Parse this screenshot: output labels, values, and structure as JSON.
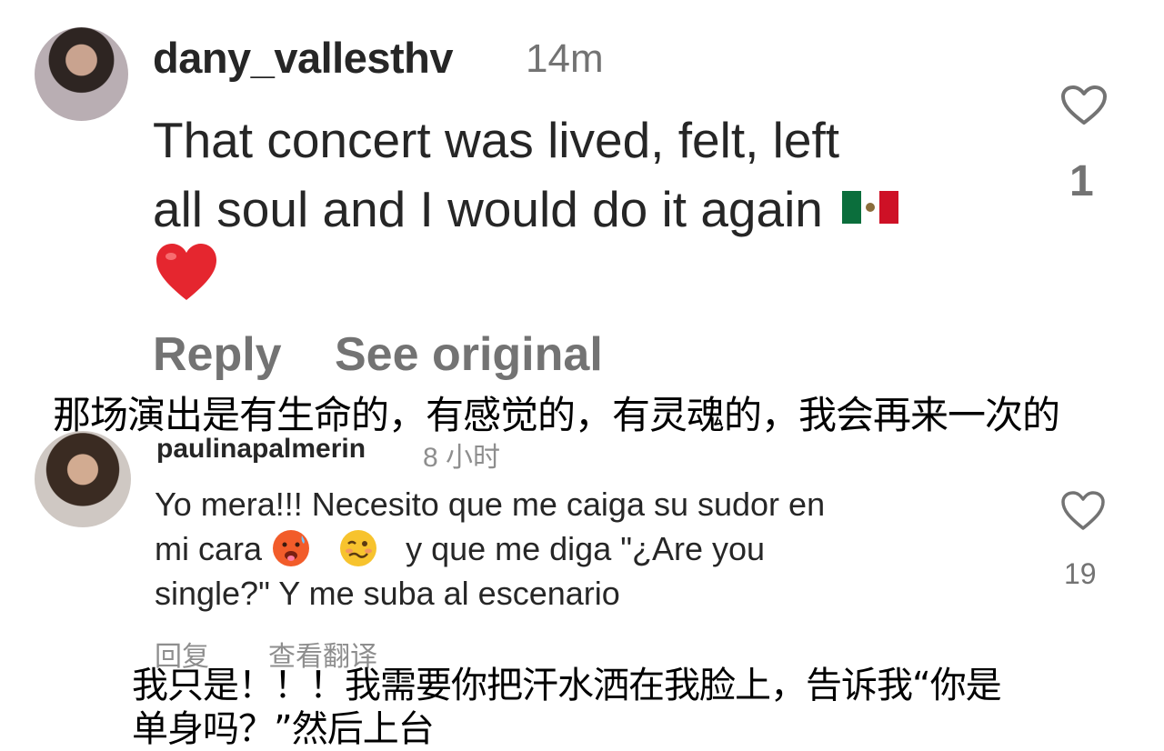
{
  "comments": [
    {
      "username": "dany_vallesthv",
      "time": "14m",
      "text_line1": "That concert was lived, felt, left",
      "text_line2": "all soul and I would do it again",
      "emojis": [
        "mexico-flag",
        "red-heart"
      ],
      "like_count": "1",
      "actions": {
        "reply": "Reply",
        "see_original": "See original"
      }
    },
    {
      "username": "paulinapalmerin",
      "time": "8 小时",
      "text_line1": "Yo mera!!! Necesito que me caiga su sudor en",
      "text_line2_a": "mi cara",
      "text_line2_b": "y que me diga \"¿Are you",
      "text_line3": "single?\" Y me suba al escenario",
      "emojis": [
        "hot-face",
        "woozy-face"
      ],
      "like_count": "19",
      "actions": {
        "reply": "回复",
        "see_translation": "查看翻译"
      }
    }
  ],
  "overlays": {
    "translation_1": "那场演出是有生命的，有感觉的，有灵魂的，我会再来一次的",
    "translation_2_line1": "我只是！！！我需要你把汗水洒在我脸上，告诉我“你是",
    "translation_2_line2": "单身吗？”然后上台"
  },
  "icons": {
    "like": "heart-outline-icon"
  },
  "colors": {
    "text": "#262626",
    "muted": "#737373",
    "heart": "#e0245e"
  }
}
